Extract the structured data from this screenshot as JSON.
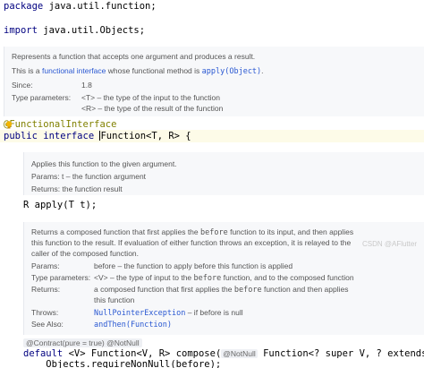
{
  "code": {
    "package_kw": "package",
    "package_rest": " java.util.function;",
    "import_kw": "import",
    "import_rest": " java.util.Objects;",
    "annotation": "@FunctionalInterface",
    "decl_kw": "public interface ",
    "decl_name": "Function",
    "decl_rest": "<T, R> {",
    "apply_sig": "R apply(T t);",
    "compose_kw": "default",
    "compose_sig_1": " <V> Function<V, R> compose(",
    "compose_notnull": "@NotNull",
    "compose_sig_2": " Function<? super V, ? extends T> before) {",
    "compose_body": "    Objects.requireNonNull(before);"
  },
  "doc_function": {
    "summary": "Represents a function that accepts one argument and produces a result.",
    "note_prefix": "This is a ",
    "note_link": "functional interface",
    "note_middle": " whose functional method is ",
    "note_method": "apply(Object)",
    "note_suffix": ".",
    "since_label": "Since:",
    "since_value": "1.8",
    "type_params_label": "Type parameters:",
    "type_param_t": "<T> – the type of the input to the function",
    "type_param_r": "<R> – the type of the result of the function"
  },
  "doc_apply": {
    "summary": "Applies this function to the given argument.",
    "params": "Params:  t – the function argument",
    "returns": "Returns: the function result"
  },
  "doc_compose": {
    "line1_a": "Returns a composed function that first applies the ",
    "line1_code": "before",
    "line1_b": " function to its input, and then applies",
    "line2": "this function to the result. If evaluation of either function throws an exception, it is relayed to the",
    "line3": "caller of the composed function.",
    "params_label": "Params:",
    "params_value": "before – the function to apply before this function is applied",
    "type_params_label": "Type parameters:",
    "type_params_a": "<V> – the type of input to the ",
    "type_params_code": "before",
    "type_params_b": " function, and to the composed function",
    "returns_label": "Returns:",
    "returns_a": "a composed function that first applies the ",
    "returns_code": "before",
    "returns_b": " function and then applies",
    "returns_c": "this function",
    "throws_label": "Throws:",
    "throws_link": "NullPointerException",
    "throws_rest": " – if before is null",
    "see_label": "See Also:",
    "see_link": "andThen(Function)"
  },
  "inline_hints": {
    "contract": "@Contract(pure = true)",
    "notnull": "@NotNull"
  },
  "watermark": "CSDN @AFlutter"
}
